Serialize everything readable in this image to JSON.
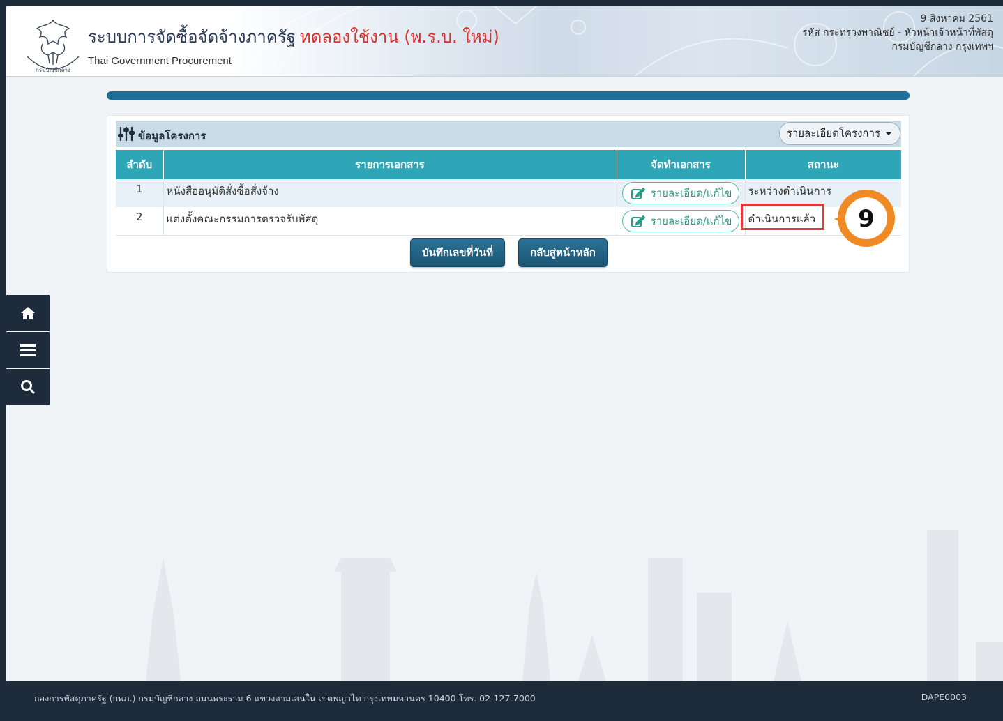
{
  "header": {
    "title": "ระบบการจัดซื้อจัดจ้างภาครัฐ",
    "title_trial": "ทดลองใช้งาน (พ.ร.บ. ใหม่)",
    "subtitle": "Thai Government Procurement",
    "logo_text": "กรมบัญชีกลาง",
    "date": "9 สิงหาคม 2561",
    "user_line": "รหัส กระทรวงพาณิชย์ - หัวหน้าเจ้าหน้าที่พัสดุ",
    "org_line": "กรมบัญชีกลาง กรุงเทพฯ"
  },
  "panel": {
    "title": "ข้อมูลโครงการ",
    "dropdown_label": "รายละเอียดโครงการ",
    "table": {
      "headers": [
        "ลำดับ",
        "รายการเอกสาร",
        "จัดทำเอกสาร",
        "สถานะ"
      ],
      "rows": [
        {
          "seq": "1",
          "doc": "หนังสืออนุมัติสั่งซื้อสั่งจ้าง",
          "action": "รายละเอียด/แก้ไข",
          "status": "ระหว่างดำเนินการ"
        },
        {
          "seq": "2",
          "doc": "แต่งตั้งคณะกรรมการตรวจรับพัสดุ",
          "action": "รายละเอียด/แก้ไข",
          "status": "ดำเนินการแล้ว"
        }
      ]
    },
    "buttons": {
      "save": "บันทึกเลขที่วันที่",
      "back": "กลับสู่หน้าหลัก"
    }
  },
  "annotation": {
    "step": "9",
    "color": "#f08a24"
  },
  "side_nav": {
    "icons": [
      "home-icon",
      "menu-icon",
      "search-icon"
    ]
  },
  "footer": {
    "address": "กองการพัสดุภาครัฐ (กพภ.) กรมบัญชีกลาง ถนนพระราม 6 แขวงสามเสนใน เขตพญาไท กรุงเทพมหานคร 10400 โทร. 02-127-7000",
    "code": "DAPE0003"
  },
  "colors": {
    "primary": "#1b6f98",
    "table_header": "#2ea6b8",
    "nav": "#1d2b3a",
    "highlight": "#e03a3a"
  }
}
